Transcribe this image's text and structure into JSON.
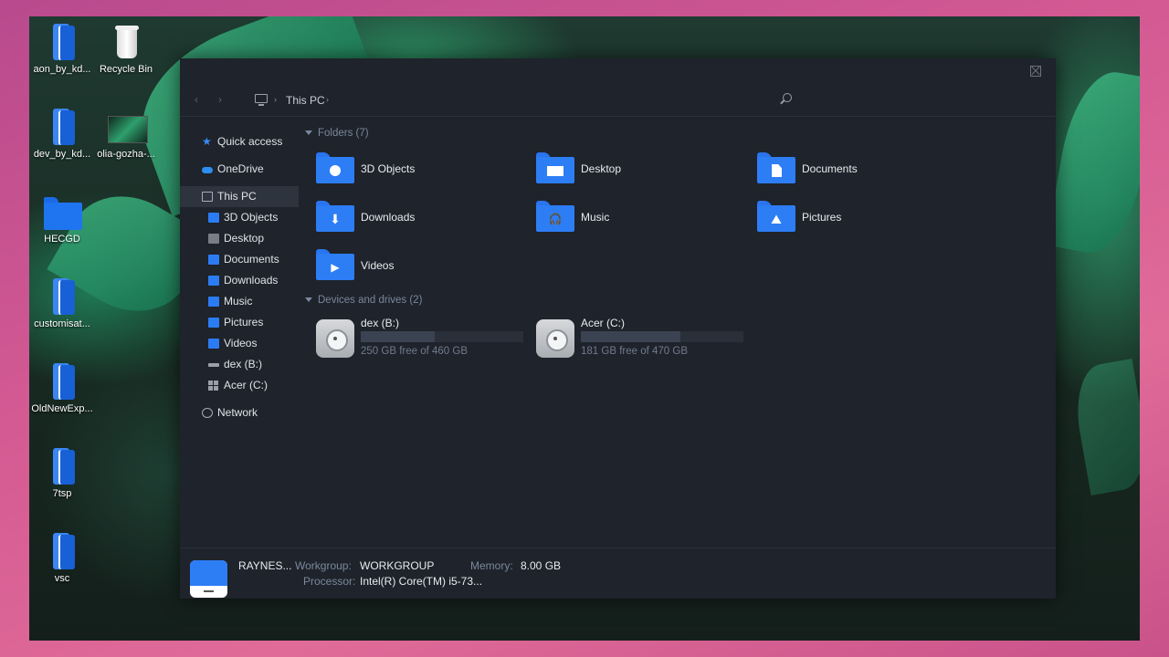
{
  "desktop": {
    "icons": [
      {
        "label": "aon_by_kd...",
        "icon": "stacked-files-icon"
      },
      {
        "label": "Recycle Bin",
        "icon": "recycle-bin-icon"
      },
      {
        "label": "dev_by_kd...",
        "icon": "stacked-files-icon"
      },
      {
        "label": "olia-gozha-...",
        "icon": "image-file-icon"
      },
      {
        "label": "HECGD",
        "icon": "folder-icon"
      },
      {
        "label": "customisat...",
        "icon": "stacked-files-icon"
      },
      {
        "label": "OldNewExp...",
        "icon": "stacked-files-icon"
      },
      {
        "label": "7tsp",
        "icon": "stacked-files-icon"
      },
      {
        "label": "vsc",
        "icon": "stacked-files-icon"
      }
    ]
  },
  "window": {
    "breadcrumb": {
      "location": "This PC",
      "separator": "›"
    },
    "nav": {
      "back": "‹",
      "forward": "›"
    }
  },
  "sidebar": {
    "items": [
      {
        "label": "Quick access",
        "icon": "star-icon"
      },
      {
        "label": "OneDrive",
        "icon": "cloud-icon"
      },
      {
        "label": "This PC",
        "icon": "computer-icon",
        "selected": true
      },
      {
        "label": "3D Objects",
        "icon": "folder-3d-icon"
      },
      {
        "label": "Desktop",
        "icon": "desktop-folder-icon"
      },
      {
        "label": "Documents",
        "icon": "documents-folder-icon"
      },
      {
        "label": "Downloads",
        "icon": "downloads-folder-icon"
      },
      {
        "label": "Music",
        "icon": "music-folder-icon"
      },
      {
        "label": "Pictures",
        "icon": "pictures-folder-icon"
      },
      {
        "label": "Videos",
        "icon": "videos-folder-icon"
      },
      {
        "label": "dex (B:)",
        "icon": "drive-icon"
      },
      {
        "label": "Acer (C:)",
        "icon": "windows-drive-icon"
      },
      {
        "label": "Network",
        "icon": "network-icon"
      }
    ]
  },
  "content": {
    "folders_heading": "Folders (7)",
    "folders": [
      {
        "label": "3D Objects",
        "icon": "3d-objects-folder-icon"
      },
      {
        "label": "Desktop",
        "icon": "desktop-folder-icon"
      },
      {
        "label": "Documents",
        "icon": "documents-folder-icon"
      },
      {
        "label": "Downloads",
        "icon": "downloads-folder-icon",
        "glyph": "⬇"
      },
      {
        "label": "Music",
        "icon": "music-folder-icon",
        "glyph": "🎧"
      },
      {
        "label": "Pictures",
        "icon": "pictures-folder-icon",
        "glyph": "⛰"
      },
      {
        "label": "Videos",
        "icon": "videos-folder-icon",
        "glyph": "▶"
      }
    ],
    "drives_heading": "Devices and drives (2)",
    "drives": [
      {
        "name": "dex (B:)",
        "free_text": "250 GB free of 460 GB",
        "used_fraction": 0.457
      },
      {
        "name": "Acer (C:)",
        "free_text": "181 GB free of 470 GB",
        "used_fraction": 0.615
      }
    ]
  },
  "details": {
    "pc_name": "RAYNES...",
    "workgroup_label": "Workgroup:",
    "workgroup_value": "WORKGROUP",
    "memory_label": "Memory:",
    "memory_value": "8.00 GB",
    "processor_label": "Processor:",
    "processor_value": "Intel(R) Core(TM) i5-73..."
  },
  "colors": {
    "window_bg": "#1f232b",
    "accent_blue": "#2d7df5",
    "muted_text": "#7a889c",
    "frame_pink": "#d45a93"
  }
}
